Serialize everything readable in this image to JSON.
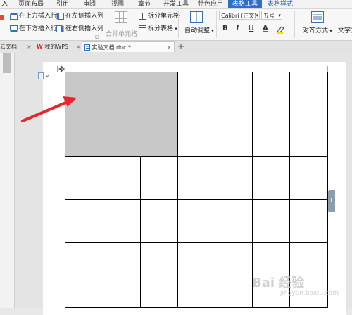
{
  "menu": {
    "items": [
      {
        "label": "入",
        "name": "menu-insert"
      },
      {
        "label": "页面布局",
        "name": "menu-page-layout"
      },
      {
        "label": "引用",
        "name": "menu-references"
      },
      {
        "label": "审阅",
        "name": "menu-review"
      },
      {
        "label": "视图",
        "name": "menu-view"
      },
      {
        "label": "章节",
        "name": "menu-chapter"
      },
      {
        "label": "开发工具",
        "name": "menu-developer"
      },
      {
        "label": "特色应用",
        "name": "menu-features"
      },
      {
        "label": "表格工具",
        "name": "menu-table-tools"
      },
      {
        "label": "表格样式",
        "name": "menu-table-style"
      }
    ]
  },
  "ribbon": {
    "insert_row_above": "在上方插入行",
    "insert_col_left": "在左侧插入列",
    "insert_row_below": "在下方插入行",
    "insert_col_right": "在右侧插入列",
    "merge_cells": "合并单元格",
    "split_cells": "拆分单元格",
    "split_table": "拆分表格",
    "autofit": "自动调整",
    "font_name": "Calibri (正文)",
    "font_size": "五号",
    "bold": "B",
    "italic": "I",
    "underline": "U",
    "font_color": "A",
    "align": "对齐方式",
    "text_dir": "文字方"
  },
  "tabs": [
    {
      "label": "云文档",
      "name": "tab-cloud-docs"
    },
    {
      "label": "我的WPS",
      "name": "tab-my-wps"
    },
    {
      "label": "实验文档.doc *",
      "name": "tab-experiment-doc"
    }
  ],
  "tab_close": "×",
  "new_tab": "+",
  "colors": {
    "accent": "#2f6fc6",
    "merged_cell": "#c8c8c8",
    "arrow": "#e8262b"
  },
  "watermark": {
    "line1": "Bai 经验",
    "line2": "jingyan.baidu.com"
  }
}
